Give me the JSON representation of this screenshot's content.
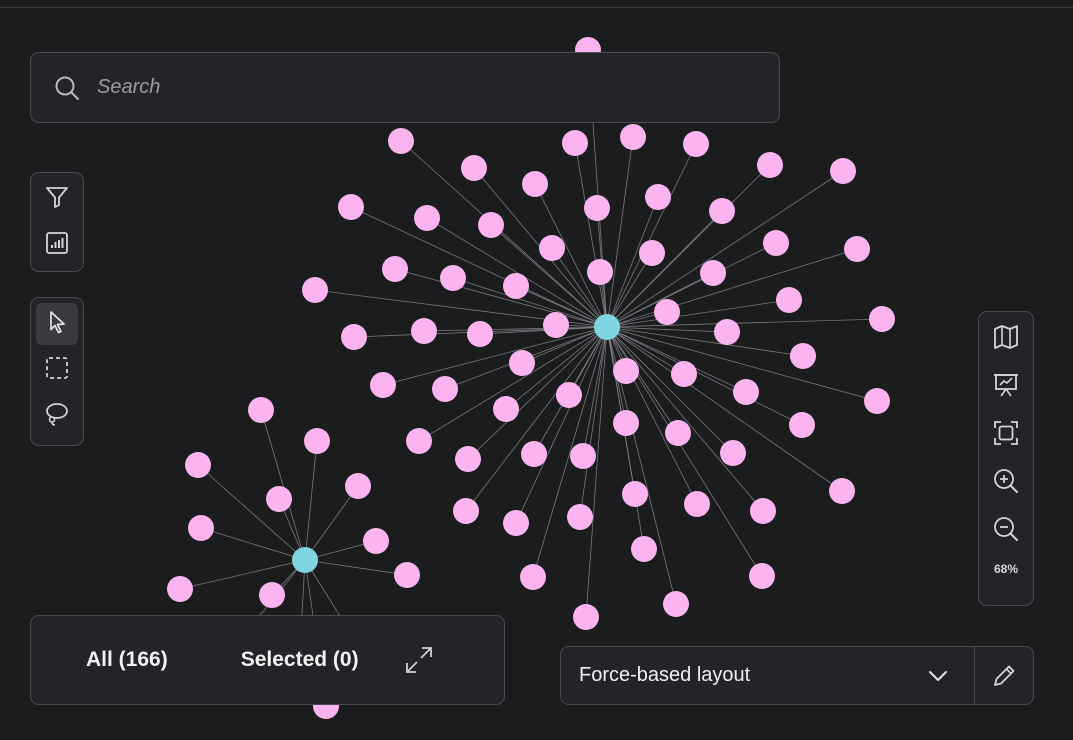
{
  "search": {
    "placeholder": "Search"
  },
  "counts": {
    "all_label": "All (166)",
    "selected_label": "Selected (0)"
  },
  "zoom": {
    "level": "68%"
  },
  "layout": {
    "selected": "Force-based layout"
  },
  "colors": {
    "node": "#fcb4f0",
    "hub": "#7fd6e2",
    "edge": "#8a8a8e",
    "background": "#1b1c1e",
    "panel": "#232427"
  },
  "icons": {
    "search": "search-icon",
    "filter": "funnel-icon",
    "stats": "bar-chart-icon",
    "pointer": "cursor-icon",
    "rect_select": "rectangle-select-icon",
    "lasso": "lasso-icon",
    "map": "map-icon",
    "presentation": "presentation-icon",
    "fit": "fit-screen-icon",
    "zoom_in": "zoom-in-icon",
    "zoom_out": "zoom-out-icon",
    "expand": "expand-icon",
    "chevron": "chevron-down-icon",
    "edit": "pencil-icon"
  }
}
